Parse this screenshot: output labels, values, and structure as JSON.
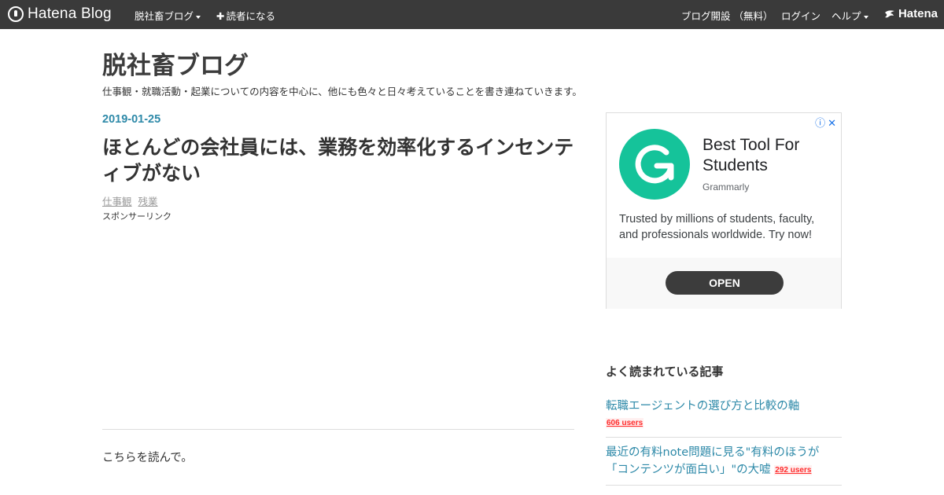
{
  "topbar": {
    "logo_text": "Hatena Blog",
    "blog_menu": "脱社畜ブログ",
    "subscribe": "読者になる",
    "open_blog": "ブログ開設 （無料）",
    "login": "ログイン",
    "help": "ヘルプ",
    "brand": "Hatena"
  },
  "header": {
    "title": "脱社畜ブログ",
    "description": "仕事観・就職活動・起業についての内容を中心に、他にも色々と日々考えていることを書き連ねていきます。"
  },
  "article": {
    "date": "2019-01-25",
    "title": "ほとんどの会社員には、業務を効率化するインセンティブがない",
    "categories": [
      "仕事観",
      "残業"
    ],
    "sponsor_label": "スポンサーリンク",
    "body_first_line": "こちらを読んで。"
  },
  "ad": {
    "headline": "Best Tool For Students",
    "advertiser": "Grammarly",
    "description": "Trusted by millions of students, faculty, and professionals worldwide. Try now!",
    "cta": "OPEN",
    "brand_color": "#15c39a"
  },
  "sidebar": {
    "popular_heading": "よく読まれている記事",
    "popular": [
      {
        "title": "転職エージェントの選び方と比較の軸",
        "users": "606 users"
      },
      {
        "title": "最近の有料note問題に見る\"有料のほうが「コンテンツが面白い」\"の大嘘",
        "users": "292 users"
      }
    ]
  },
  "colors": {
    "topbar": "#3a3a3a",
    "link": "#2d89a8",
    "users_badge": "#ff2b2b"
  }
}
